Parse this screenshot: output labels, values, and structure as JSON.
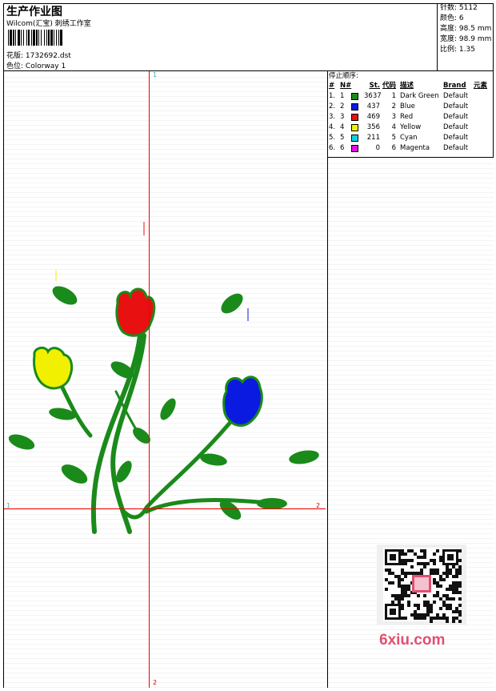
{
  "header": {
    "title": "生产作业图",
    "subtitle": "Wilcom(汇宝) 刺绣工作室",
    "design_label": "花版:",
    "design_value": "1732692.dst",
    "colorway_label": "色位:",
    "colorway_value": "Colorway 1"
  },
  "stats": {
    "stitches_label": "针数:",
    "stitches_value": "5112",
    "colors_label": "颜色:",
    "colors_value": "6",
    "height_label": "高度:",
    "height_value": "98.5 mm",
    "width_label": "宽度:",
    "width_value": "98.9 mm",
    "scale_label": "比例:",
    "scale_value": "1.35"
  },
  "stop_sequence": {
    "title": "停止顺序:",
    "headers": [
      "#",
      "N#",
      "St.",
      "代码",
      "描述",
      "Brand",
      "元素"
    ],
    "rows": [
      {
        "num": "1.",
        "n": "1",
        "color": "#1a8a1a",
        "st": "3637",
        "code": "1",
        "desc": "Dark Green",
        "brand": "Default"
      },
      {
        "num": "2.",
        "n": "2",
        "color": "#0a1ae0",
        "st": "437",
        "code": "2",
        "desc": "Blue",
        "brand": "Default"
      },
      {
        "num": "3.",
        "n": "3",
        "color": "#e81010",
        "st": "469",
        "code": "3",
        "desc": "Red",
        "brand": "Default"
      },
      {
        "num": "4.",
        "n": "4",
        "color": "#f0f000",
        "st": "356",
        "code": "4",
        "desc": "Yellow",
        "brand": "Default"
      },
      {
        "num": "5.",
        "n": "5",
        "color": "#10d0e0",
        "st": "211",
        "code": "5",
        "desc": "Cyan",
        "brand": "Default"
      },
      {
        "num": "6.",
        "n": "6",
        "color": "#e010e0",
        "st": "0",
        "code": "6",
        "desc": "Magenta",
        "brand": "Default"
      }
    ]
  },
  "axes": {
    "top": "1",
    "left": "1",
    "right": "2",
    "bottom": "2"
  },
  "watermark": {
    "brand": "6xiu.com"
  }
}
